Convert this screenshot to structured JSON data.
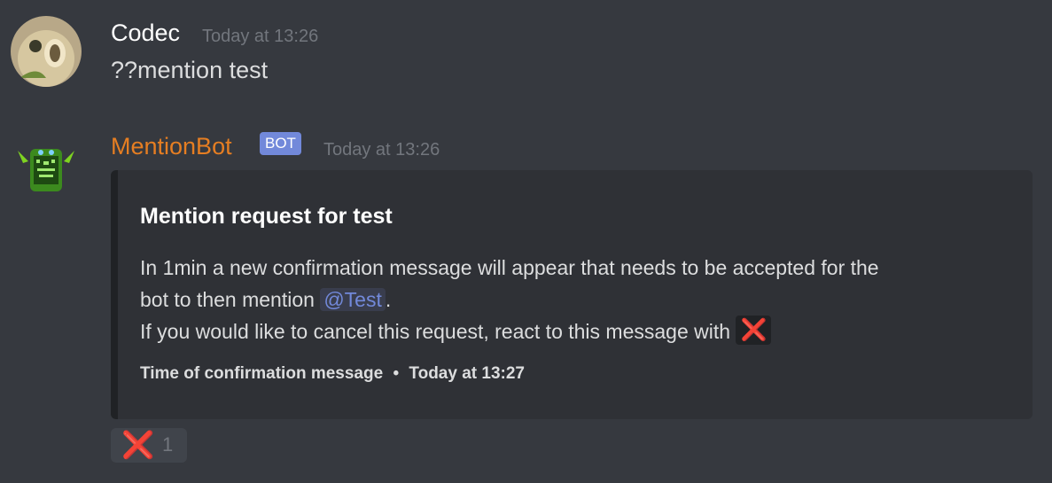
{
  "messages": [
    {
      "author": "Codec",
      "timestamp": "Today at 13:26",
      "content": "??mention test"
    },
    {
      "author": "MentionBot",
      "bot_tag": "BOT",
      "timestamp": "Today at 13:26",
      "author_color": "#e67e22",
      "embed": {
        "title": "Mention request for test",
        "desc_line1": "In 1min a new confirmation message will appear that needs to be accepted for the",
        "desc_line2_prefix": "bot to then mention ",
        "mention": "@Test",
        "desc_line2_suffix": ".",
        "desc_line3": "If you would like to cancel this request, react to this message with ",
        "emoji": "❌",
        "footer_label": "Time of confirmation message",
        "footer_sep": "•",
        "footer_time": "Today at 13:27"
      },
      "reactions": [
        {
          "emoji": "❌",
          "count": "1"
        }
      ]
    }
  ],
  "colors": {
    "background": "#36393f",
    "embed_bg": "#2f3136",
    "blurple": "#7289da",
    "muted": "#72767d"
  }
}
